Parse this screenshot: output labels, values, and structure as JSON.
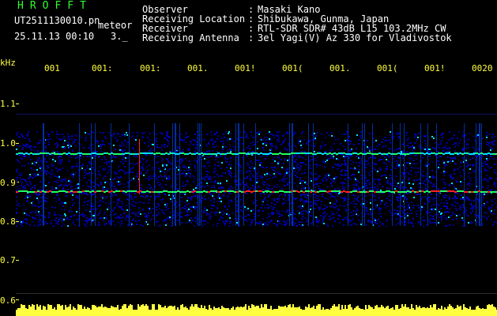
{
  "header": {
    "title": "HROFFT",
    "filename": "UT2511130010.pn",
    "tag": "meteor",
    "datetime": "25.11.13 00:10",
    "datetime_extra": "3._"
  },
  "info": [
    {
      "label": "Observer",
      "value": "Masaki Kano"
    },
    {
      "label": "Receiving Location",
      "value": "Shibukawa, Gunma, Japan"
    },
    {
      "label": "Receiver",
      "value": "RTL-SDR SDR# 43dB L15 103.2MHz CW"
    },
    {
      "label": "Receiving Antenna",
      "value": "3el Yagi(V) Az 330 for Vladivostok"
    }
  ],
  "axis": {
    "unit": "kHz",
    "time_ticks": [
      "001",
      "001:",
      "001:",
      "001.",
      "001!",
      "001(",
      "001.",
      "001(",
      "001!",
      "0020"
    ],
    "y_ticks": [
      "1.1",
      "1.0",
      "0.9",
      "0.8",
      "0.7",
      "0.6"
    ]
  },
  "colors": {
    "label_green": "#30ff30",
    "text_white": "#ffffff",
    "axis_yellow": "#ffff40",
    "noise_blue": "#0000c0",
    "signal_cyan": "#00e0ff",
    "signal_red": "#ff2020",
    "signal_green": "#20ff60"
  }
}
